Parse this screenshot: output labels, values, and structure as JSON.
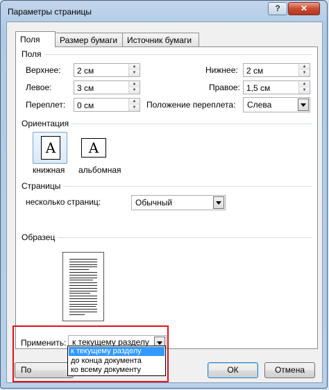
{
  "window": {
    "title": "Параметры страницы",
    "help_label": "?",
    "close_label": "✕"
  },
  "tabs": [
    {
      "label": "Поля",
      "active": true
    },
    {
      "label": "Размер бумаги",
      "active": false
    },
    {
      "label": "Источник бумаги",
      "active": false
    }
  ],
  "margins": {
    "group_label": "Поля",
    "top": {
      "label": "Верхнее:",
      "value": "2 см"
    },
    "bottom": {
      "label": "Нижнее:",
      "value": "2 см"
    },
    "left": {
      "label": "Левое:",
      "value": "3 см"
    },
    "right": {
      "label": "Правое:",
      "value": "1,5 см"
    },
    "gutter": {
      "label": "Переплет:",
      "value": "0 см"
    },
    "gutter_position": {
      "label": "Положение переплета:",
      "value": "Слева"
    }
  },
  "orientation": {
    "group_label": "Ориентация",
    "portrait": {
      "label": "книжная",
      "glyph": "A",
      "selected": true
    },
    "landscape": {
      "label": "альбомная",
      "glyph": "A",
      "selected": false
    }
  },
  "pages": {
    "group_label": "Страницы",
    "multiple_label": "несколько страниц:",
    "multiple_value": "Обычный"
  },
  "preview": {
    "group_label": "Образец"
  },
  "apply": {
    "label": "Применить:",
    "value": "к текущему разделу",
    "options": [
      "к текущему разделу",
      "до конца документа",
      "ко всему документу"
    ],
    "selected_index": 0
  },
  "buttons": {
    "default_label": "По умолчанию...",
    "ok_label": "ОК",
    "cancel_label": "Отмена"
  },
  "colors": {
    "highlight": "#e0101b",
    "selection": "#3399ff"
  }
}
